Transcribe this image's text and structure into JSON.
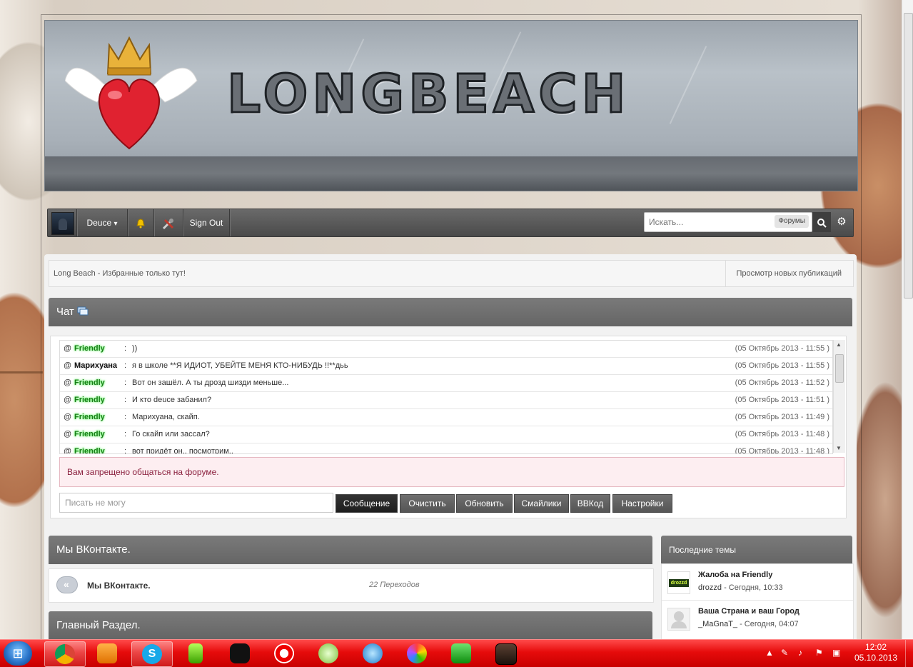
{
  "site": {
    "logo_text": "LONGBEACH"
  },
  "userbar": {
    "username": "Deuce",
    "dropdown_glyph": "▾",
    "notifications_icon": "bell-icon",
    "moderation_icon": "tools-icon",
    "sign_out": "Sign Out",
    "search_placeholder": "Искать...",
    "search_scope": "Форумы"
  },
  "breadcrumb": {
    "text": "Long Beach - Избранные только тут!",
    "new_posts": "Просмотр новых публикаций"
  },
  "chat": {
    "title": "Чат",
    "messages": [
      {
        "nick": "Friendly",
        "style": "friendly",
        "text": "))",
        "time": "(05 Октябрь 2013 - 11:55 )"
      },
      {
        "nick": "Марихуана",
        "style": "other",
        "text": "я в школе **Я ИДИОТ, УБЕЙТЕ МЕНЯ КТО-НИБУДЬ !!**дьь",
        "time": "(05 Октябрь 2013 - 11:55 )"
      },
      {
        "nick": "Friendly",
        "style": "friendly",
        "text": "Вот он зашёл. А ты дрозд шизди меньше...",
        "time": "(05 Октябрь 2013 - 11:52 )"
      },
      {
        "nick": "Friendly",
        "style": "friendly",
        "text": "И кто deuce забанил?",
        "time": "(05 Октябрь 2013 - 11:51 )"
      },
      {
        "nick": "Friendly",
        "style": "friendly",
        "text": "Марихуана, скайп.",
        "time": "(05 Октябрь 2013 - 11:49 )"
      },
      {
        "nick": "Friendly",
        "style": "friendly",
        "text": "Го скайп или зассал?",
        "time": "(05 Октябрь 2013 - 11:48 )"
      },
      {
        "nick": "Friendly",
        "style": "friendly",
        "text": "вот придёт он.. посмотрим..",
        "time": "(05 Октябрь 2013 - 11:48 )"
      }
    ],
    "denied": "Вам запрещено общаться на форуме.",
    "input_placeholder": "Писать не могу",
    "buttons": {
      "send": "Сообщение",
      "clear": "Очистить",
      "refresh": "Обновить",
      "smilies": "Смайлики",
      "bbcode": "BBКод",
      "settings": "Настройки"
    }
  },
  "vk": {
    "header": "Мы ВКонтакте.",
    "link_title": "Мы ВКонтакте.",
    "redirects": "22 Переходов"
  },
  "main_section": {
    "header": "Главный Раздел."
  },
  "latest_topics": {
    "header": "Последние темы",
    "items": [
      {
        "title": "Жалоба на Friendly",
        "author": "drozzd",
        "when": " - Сегодня, 10:33"
      },
      {
        "title": "Ваша Страна и ваш Город",
        "author": "_MaGnaT_",
        "when": " - Сегодня, 04:07"
      }
    ]
  },
  "taskbar": {
    "time": "12:02",
    "date": "05.10.2013"
  }
}
